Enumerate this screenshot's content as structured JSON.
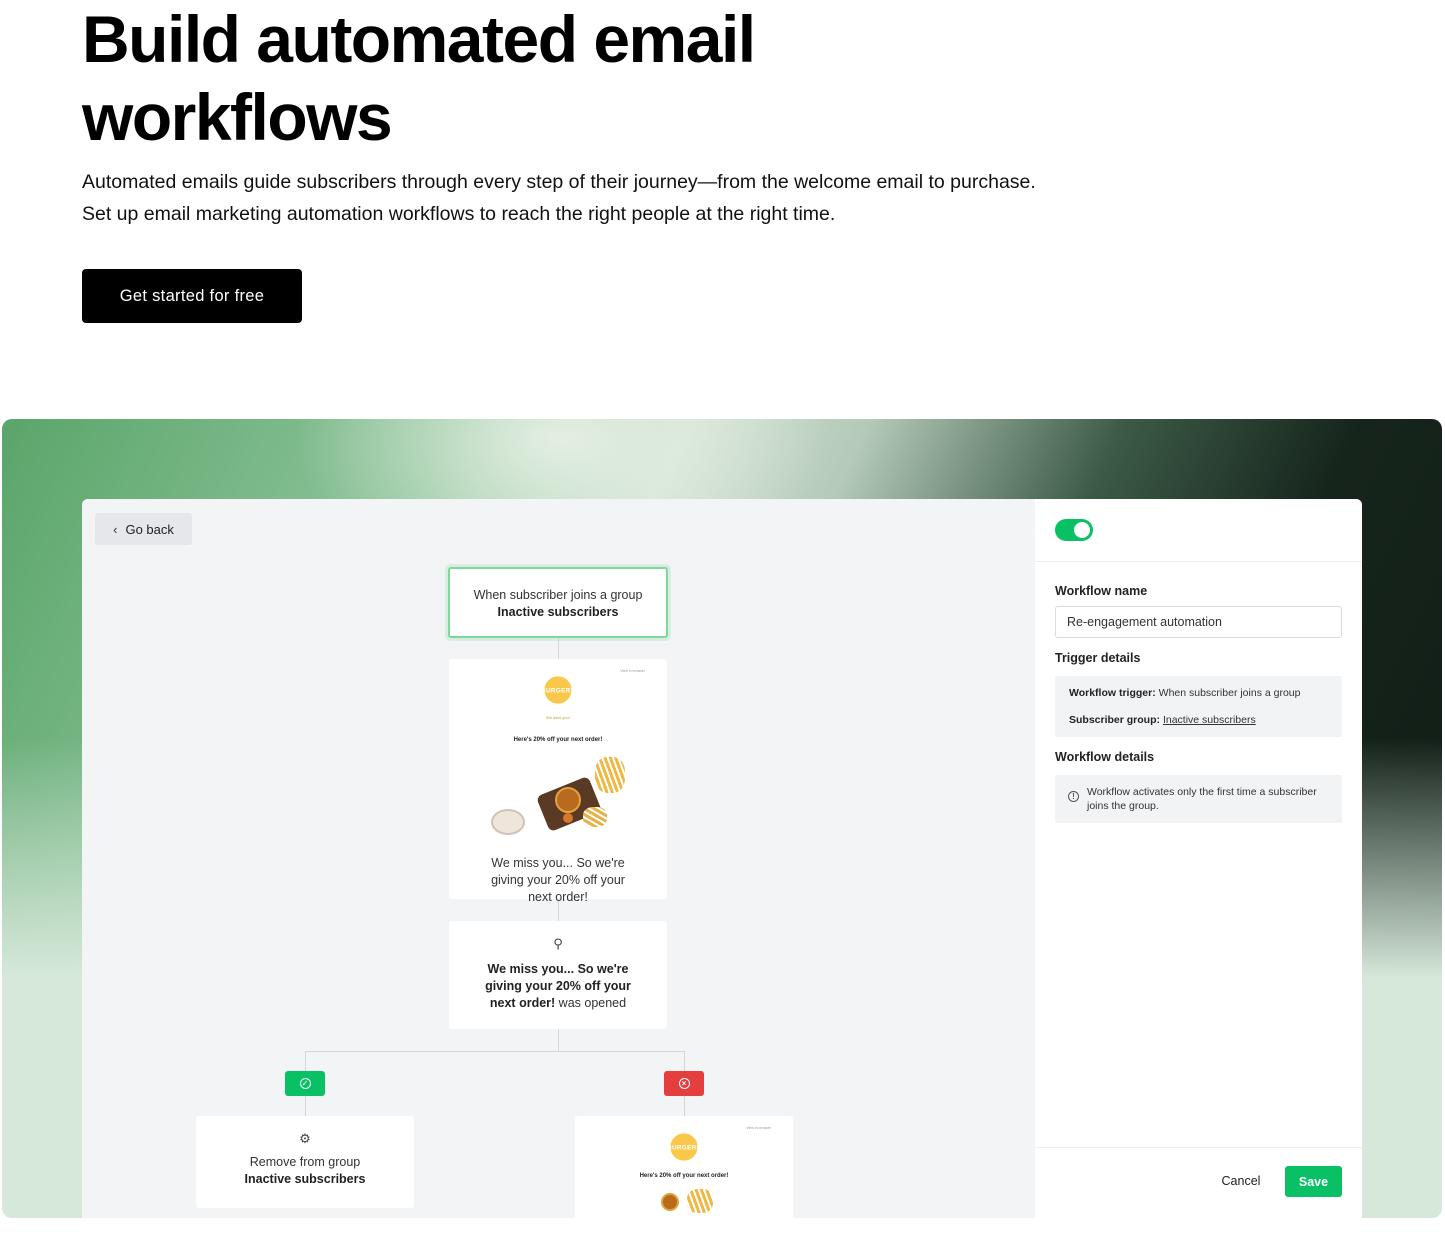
{
  "hero": {
    "title": "Build automated email workflows",
    "subtitle": "Automated emails guide subscribers through every step of their journey—from the welcome email to purchase. Set up email marketing automation workflows to reach the right people at the right time.",
    "cta_label": "Get started for free"
  },
  "editor": {
    "go_back_label": "Go back",
    "trigger_node": {
      "prefix": "When subscriber joins a group",
      "group": "Inactive subscribers"
    },
    "email_node": {
      "preview_tag": "View in browser",
      "logo_text": "BURGERS",
      "preview_small": "We miss you!",
      "preview_heading": "Here's 20% off your next order!",
      "caption": "We miss you... So we're giving your 20% off your next order!"
    },
    "condition_node": {
      "email_name": "We miss you... So we're giving your 20% off your next order!",
      "suffix": "was opened"
    },
    "action_node": {
      "action": "Remove from group",
      "group": "Inactive subscribers"
    },
    "email_node_2": {
      "preview_tag": "View in browser",
      "logo_text": "BURGERS",
      "preview_heading": "Here's 20% off your next order!"
    }
  },
  "panel": {
    "toggle_on": true,
    "workflow_name_label": "Workflow name",
    "workflow_name_value": "Re-engagement automation",
    "trigger_details_label": "Trigger details",
    "trigger_label": "Workflow trigger:",
    "trigger_value": "When subscriber joins a group",
    "group_label": "Subscriber group:",
    "group_value": "Inactive subscribers",
    "workflow_details_label": "Workflow details",
    "workflow_details_note": "Workflow activates only the first time a subscriber joins the group.",
    "cancel_label": "Cancel",
    "save_label": "Save"
  },
  "colors": {
    "accent": "#0ac064",
    "danger": "#e53e3e",
    "cta_bg": "#000000"
  }
}
